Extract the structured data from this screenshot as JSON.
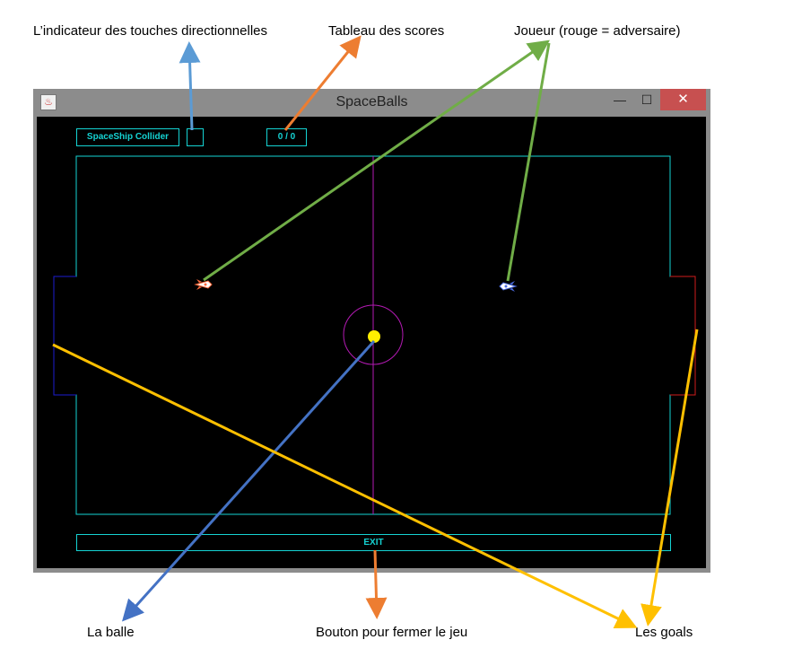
{
  "annotations": {
    "direction_indicator": "L’indicateur des touches directionnelles",
    "scoreboard": "Tableau des scores",
    "player": "Joueur (rouge = adversaire)",
    "ball": "La balle",
    "exit_button": "Bouton pour fermer le jeu",
    "goals": "Les goals"
  },
  "window": {
    "title": "SpaceBalls",
    "minimize_symbol": "—",
    "maximize_symbol": "☐",
    "close_symbol": "✕"
  },
  "hud": {
    "game_name": "SpaceShip Collider",
    "direction_indicator": "",
    "score": "0 / 0"
  },
  "game": {
    "exit_label": "EXIT"
  },
  "colors": {
    "field_border": "#15d3d3",
    "center_line": "#b41ab4",
    "ball": "#ffee00",
    "goal_left": "#1b1bd0",
    "goal_right": "#d01b1b",
    "arrow_blue_light": "#5b9bd5",
    "arrow_orange": "#ed7d31",
    "arrow_green": "#70ad47",
    "arrow_blue_dark": "#4472c4",
    "arrow_yellow": "#ffc000"
  },
  "icons": [
    "java-app-icon",
    "spaceship-icon",
    "minimize-icon",
    "maximize-icon",
    "close-icon"
  ]
}
